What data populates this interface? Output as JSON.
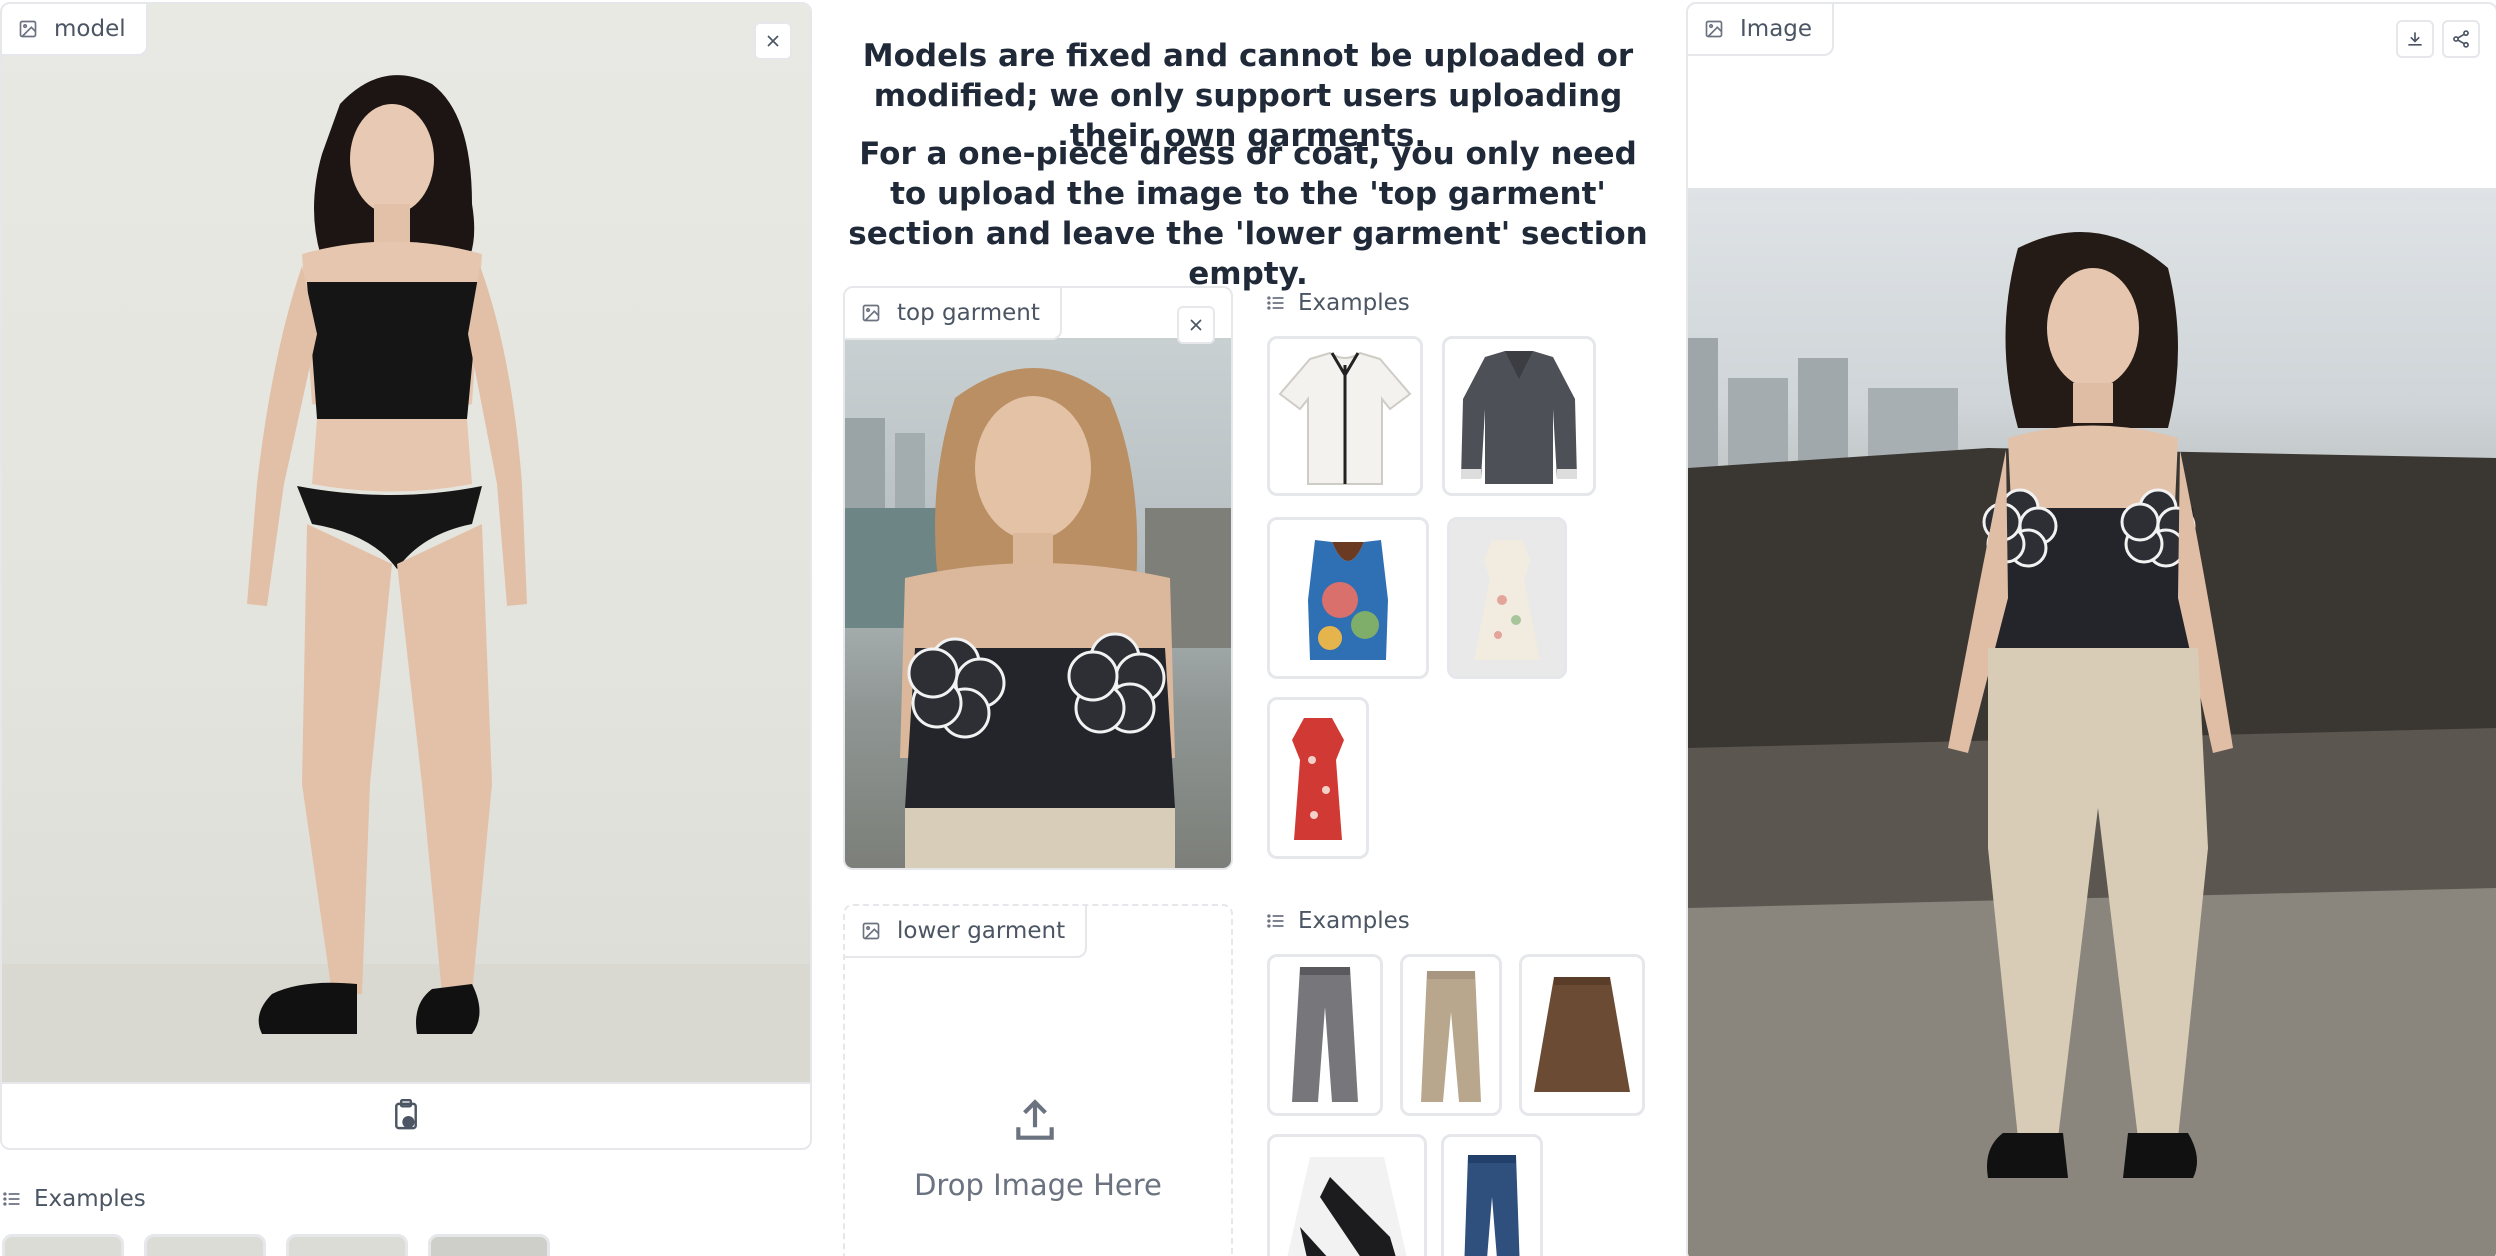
{
  "model_panel": {
    "label": "model",
    "label_icon": "image-icon",
    "close_icon": "close-icon",
    "paste_icon": "clipboard-image-icon"
  },
  "model_examples": {
    "label": "Examples",
    "icon": "list-icon"
  },
  "instructions": {
    "line1": "Models are fixed and cannot be uploaded or modified; we only support users uploading their own garments.",
    "line2": "For a one-piece dress or coat, you only need to upload the image to the 'top garment' section and leave the 'lower garment' section empty."
  },
  "top_garment": {
    "label": "top garment",
    "label_icon": "image-icon",
    "close_icon": "close-icon"
  },
  "top_examples": {
    "label": "Examples",
    "icon": "list-icon",
    "items": [
      "white-shirt-thumb",
      "gray-polo-sweater-thumb",
      "floral-vest-thumb",
      "floral-dress-thumb",
      "red-dress-thumb"
    ]
  },
  "lower_garment": {
    "label": "lower garment",
    "label_icon": "image-icon",
    "upload_icon": "upload-icon",
    "drop_text": "Drop Image Here"
  },
  "lower_examples": {
    "label": "Examples",
    "icon": "list-icon",
    "items": [
      "gray-trousers-thumb",
      "beige-pants-thumb",
      "brown-skirt-thumb",
      "striped-skirt-thumb",
      "blue-jeans-thumb"
    ]
  },
  "result_panel": {
    "label": "Image",
    "label_icon": "image-icon",
    "download_icon": "download-icon",
    "share_icon": "share-icon"
  },
  "colors": {
    "border": "#e5e7eb",
    "text": "#1f2937",
    "muted": "#4b5563"
  }
}
